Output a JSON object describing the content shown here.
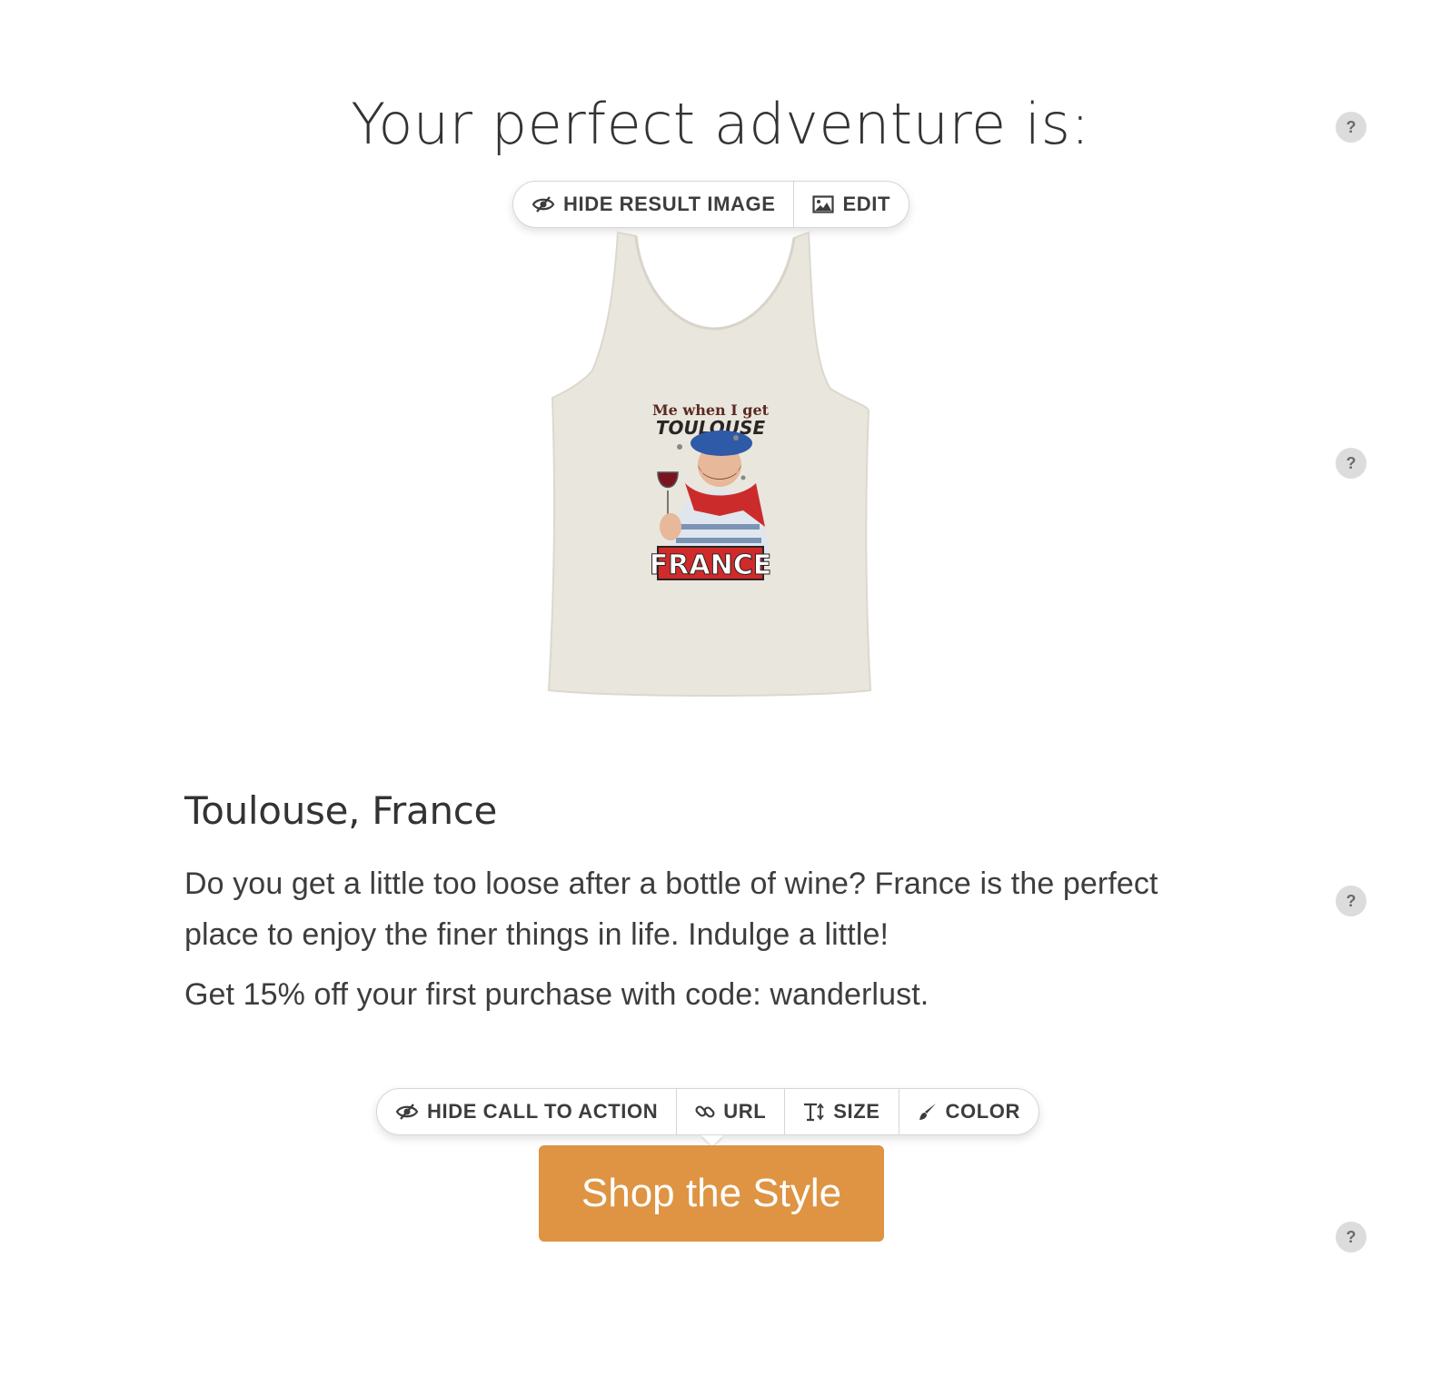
{
  "page": {
    "title": "Your perfect adventure is:"
  },
  "image_toolbar": {
    "hide_label": "HIDE RESULT IMAGE",
    "edit_label": "EDIT"
  },
  "result_image": {
    "print_line1": "Me when I get",
    "print_line2": "TOULOUSE",
    "print_line3": "FRANCE"
  },
  "result": {
    "heading": "Toulouse, France",
    "description": "Do you get a little too loose after a bottle of wine? France is the perfect place to enjoy the finer things in life. Indulge a little!",
    "promo": "Get 15% off your first purchase with code: wanderlust."
  },
  "cta_toolbar": {
    "hide_label": "HIDE CALL TO ACTION",
    "url_label": "URL",
    "size_label": "SIZE",
    "color_label": "COLOR"
  },
  "cta": {
    "label": "Shop the Style",
    "color": "#de9442"
  },
  "help": {
    "label": "?"
  },
  "colors": {
    "tank": "#e9e6dd",
    "help_bg": "#dcdcdc"
  }
}
